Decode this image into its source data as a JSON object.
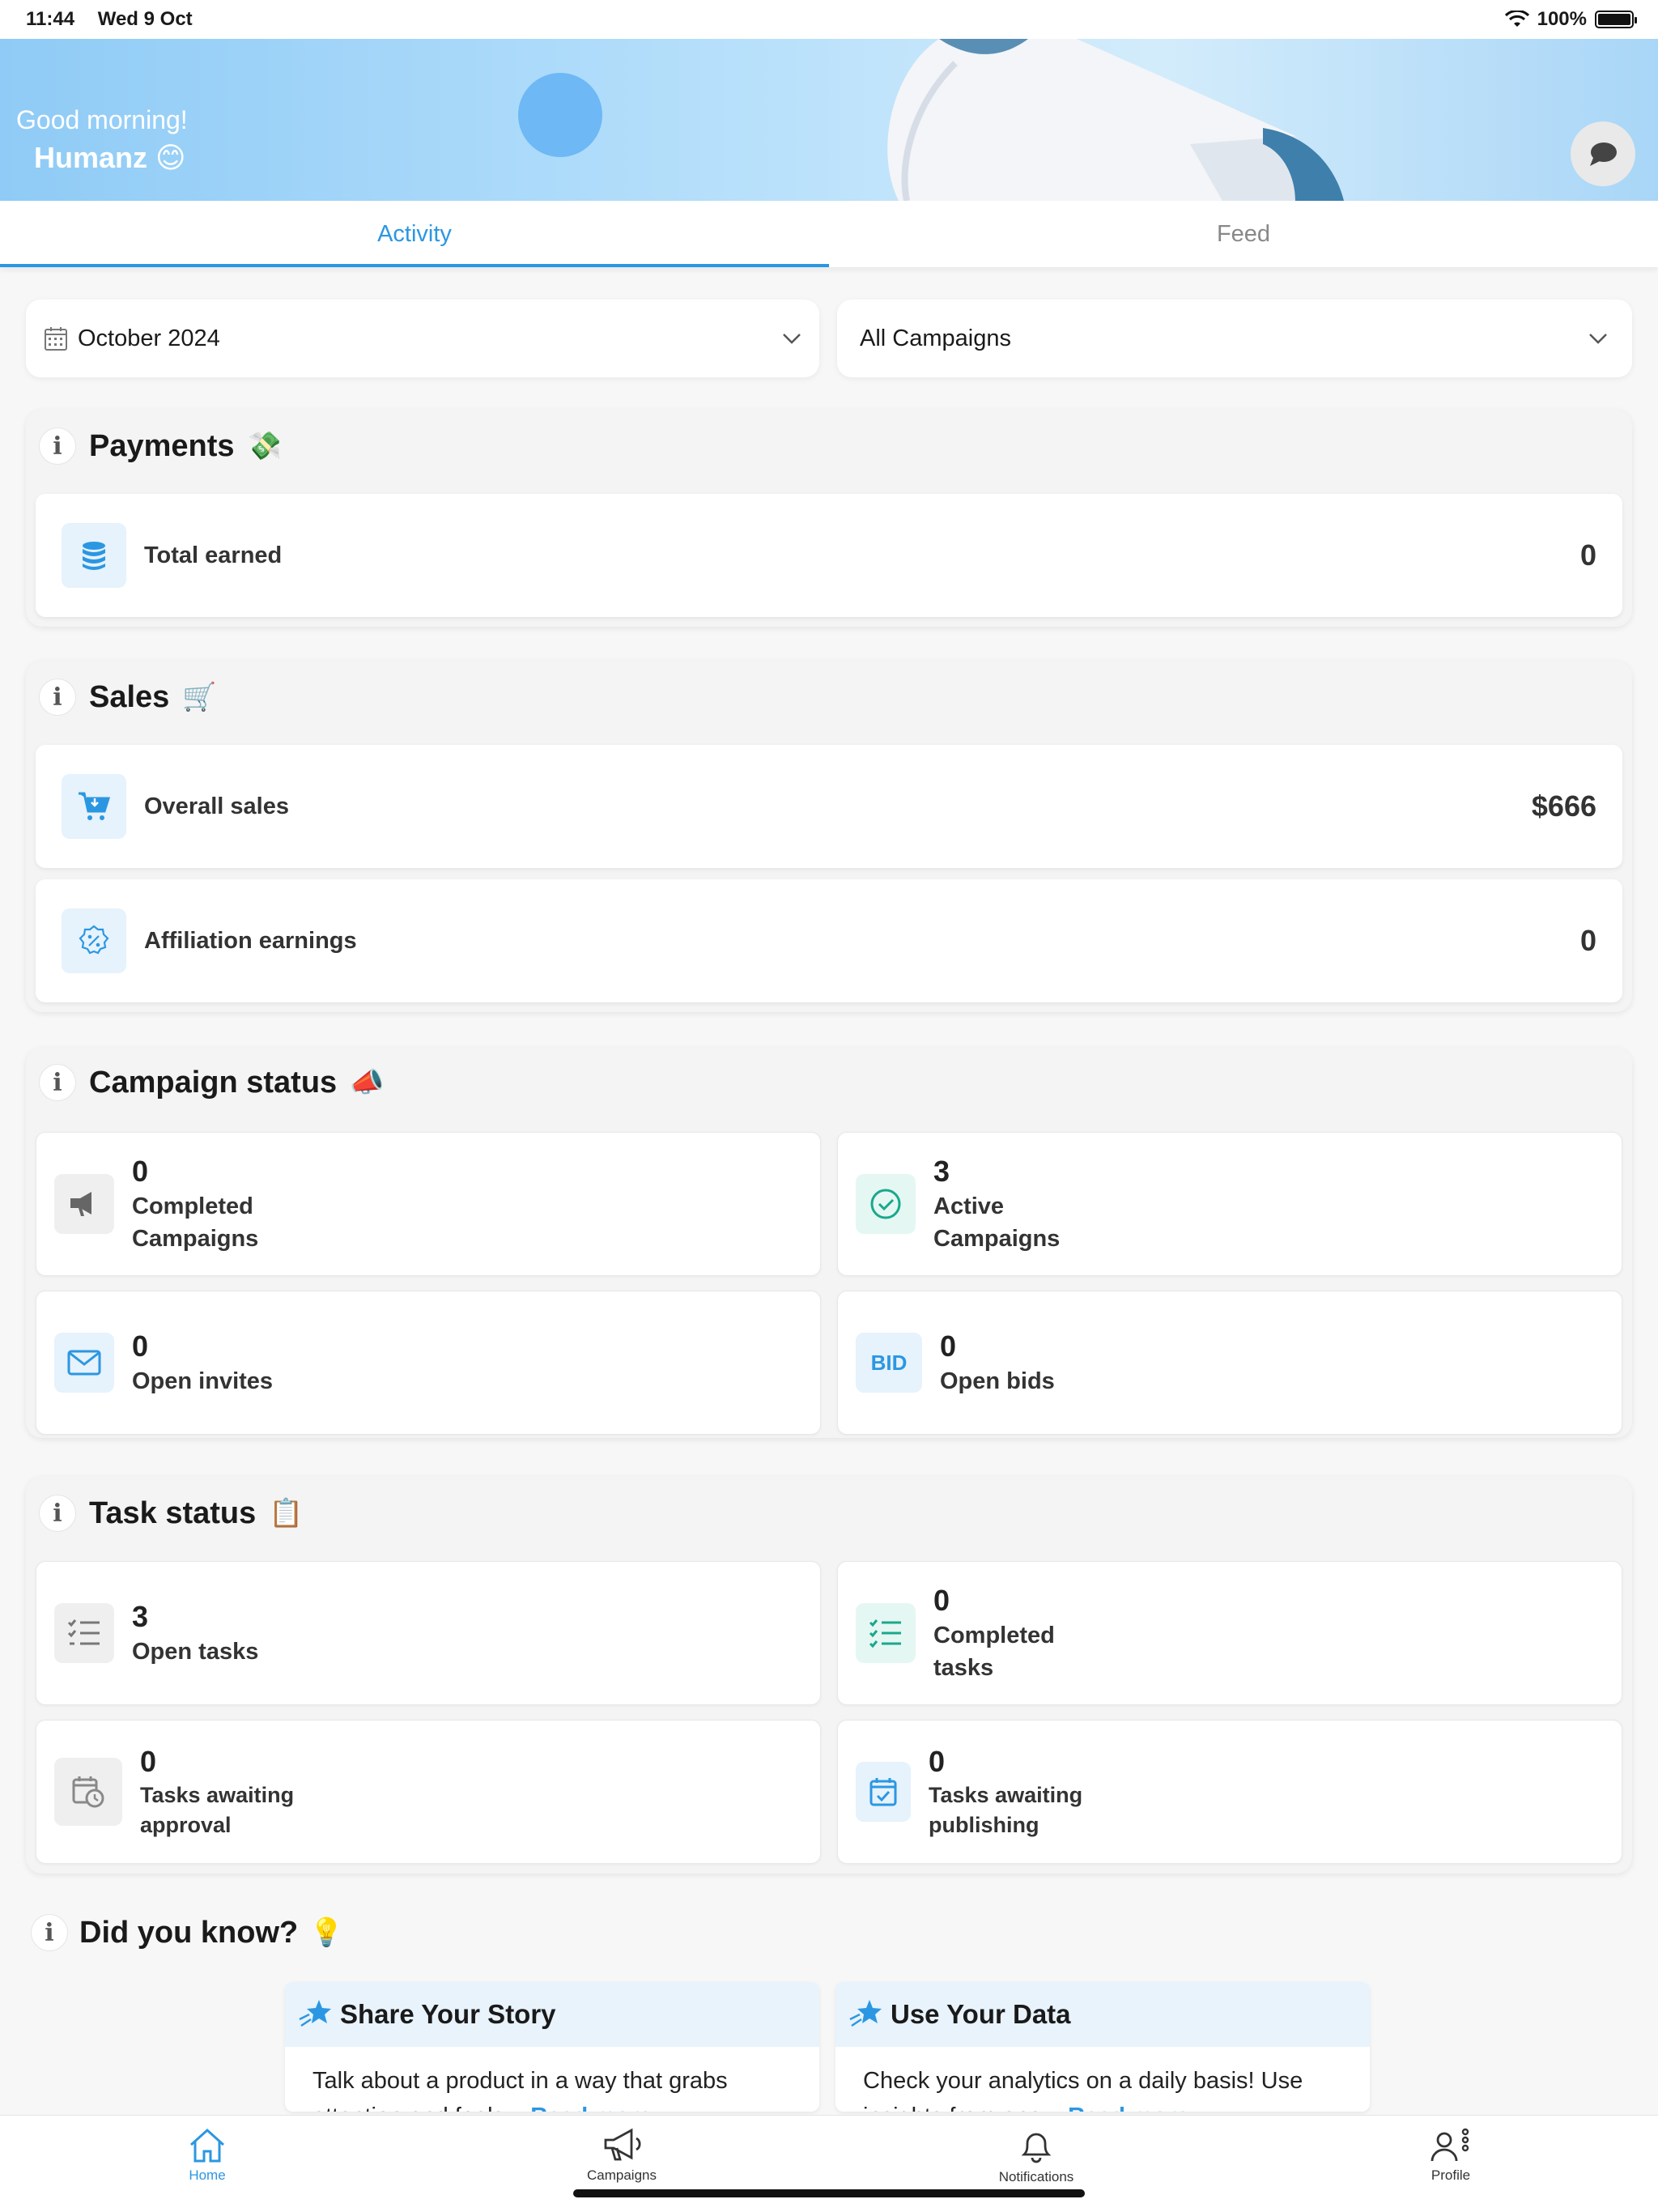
{
  "status_bar": {
    "time": "11:44",
    "date": "Wed 9 Oct",
    "battery": "100%"
  },
  "hero": {
    "greeting": "Good morning!",
    "name": "Humanz 😊"
  },
  "tabs": [
    {
      "label": "Activity"
    },
    {
      "label": "Feed"
    }
  ],
  "filters": {
    "month": "October 2024",
    "campaigns": "All Campaigns"
  },
  "payments": {
    "title": "Payments",
    "emoji": "💸",
    "total_earned": {
      "label": "Total earned",
      "value": "0"
    }
  },
  "sales": {
    "title": "Sales",
    "emoji": "🛒",
    "overall": {
      "label": "Overall sales",
      "value": "$666"
    },
    "affiliation": {
      "label": "Affiliation earnings",
      "value": "0"
    }
  },
  "campaign_status": {
    "title": "Campaign status",
    "emoji": "📣",
    "completed": {
      "value": "0",
      "label": "Completed\nCampaigns"
    },
    "active": {
      "value": "3",
      "label": "Active\nCampaigns"
    },
    "invites": {
      "value": "0",
      "label": "Open invites"
    },
    "bids": {
      "value": "0",
      "label": "Open bids",
      "icon_text": "BID"
    }
  },
  "task_status": {
    "title": "Task status",
    "emoji": "📋",
    "open": {
      "value": "3",
      "label": "Open tasks"
    },
    "completed": {
      "value": "0",
      "label": "Completed\ntasks"
    },
    "awaiting_approval": {
      "value": "0",
      "label": "Tasks awaiting\napproval"
    },
    "awaiting_publishing": {
      "value": "0",
      "label": "Tasks awaiting\npublishing"
    }
  },
  "did_you_know": {
    "title": "Did you know?",
    "emoji": "💡",
    "tips": [
      {
        "title": "Share Your Story",
        "body": "Talk about a product in a way that grabs attention and feels...",
        "more": "Read more"
      },
      {
        "title": "Use Your Data",
        "body": "Check your analytics on a daily basis! Use insights from ana...",
        "more": "Read more"
      }
    ]
  },
  "nav": [
    {
      "label": "Home"
    },
    {
      "label": "Campaigns"
    },
    {
      "label": "Notifications"
    },
    {
      "label": "Profile"
    }
  ],
  "colors": {
    "accent": "#2b97e2",
    "teal": "#1aa88c"
  }
}
